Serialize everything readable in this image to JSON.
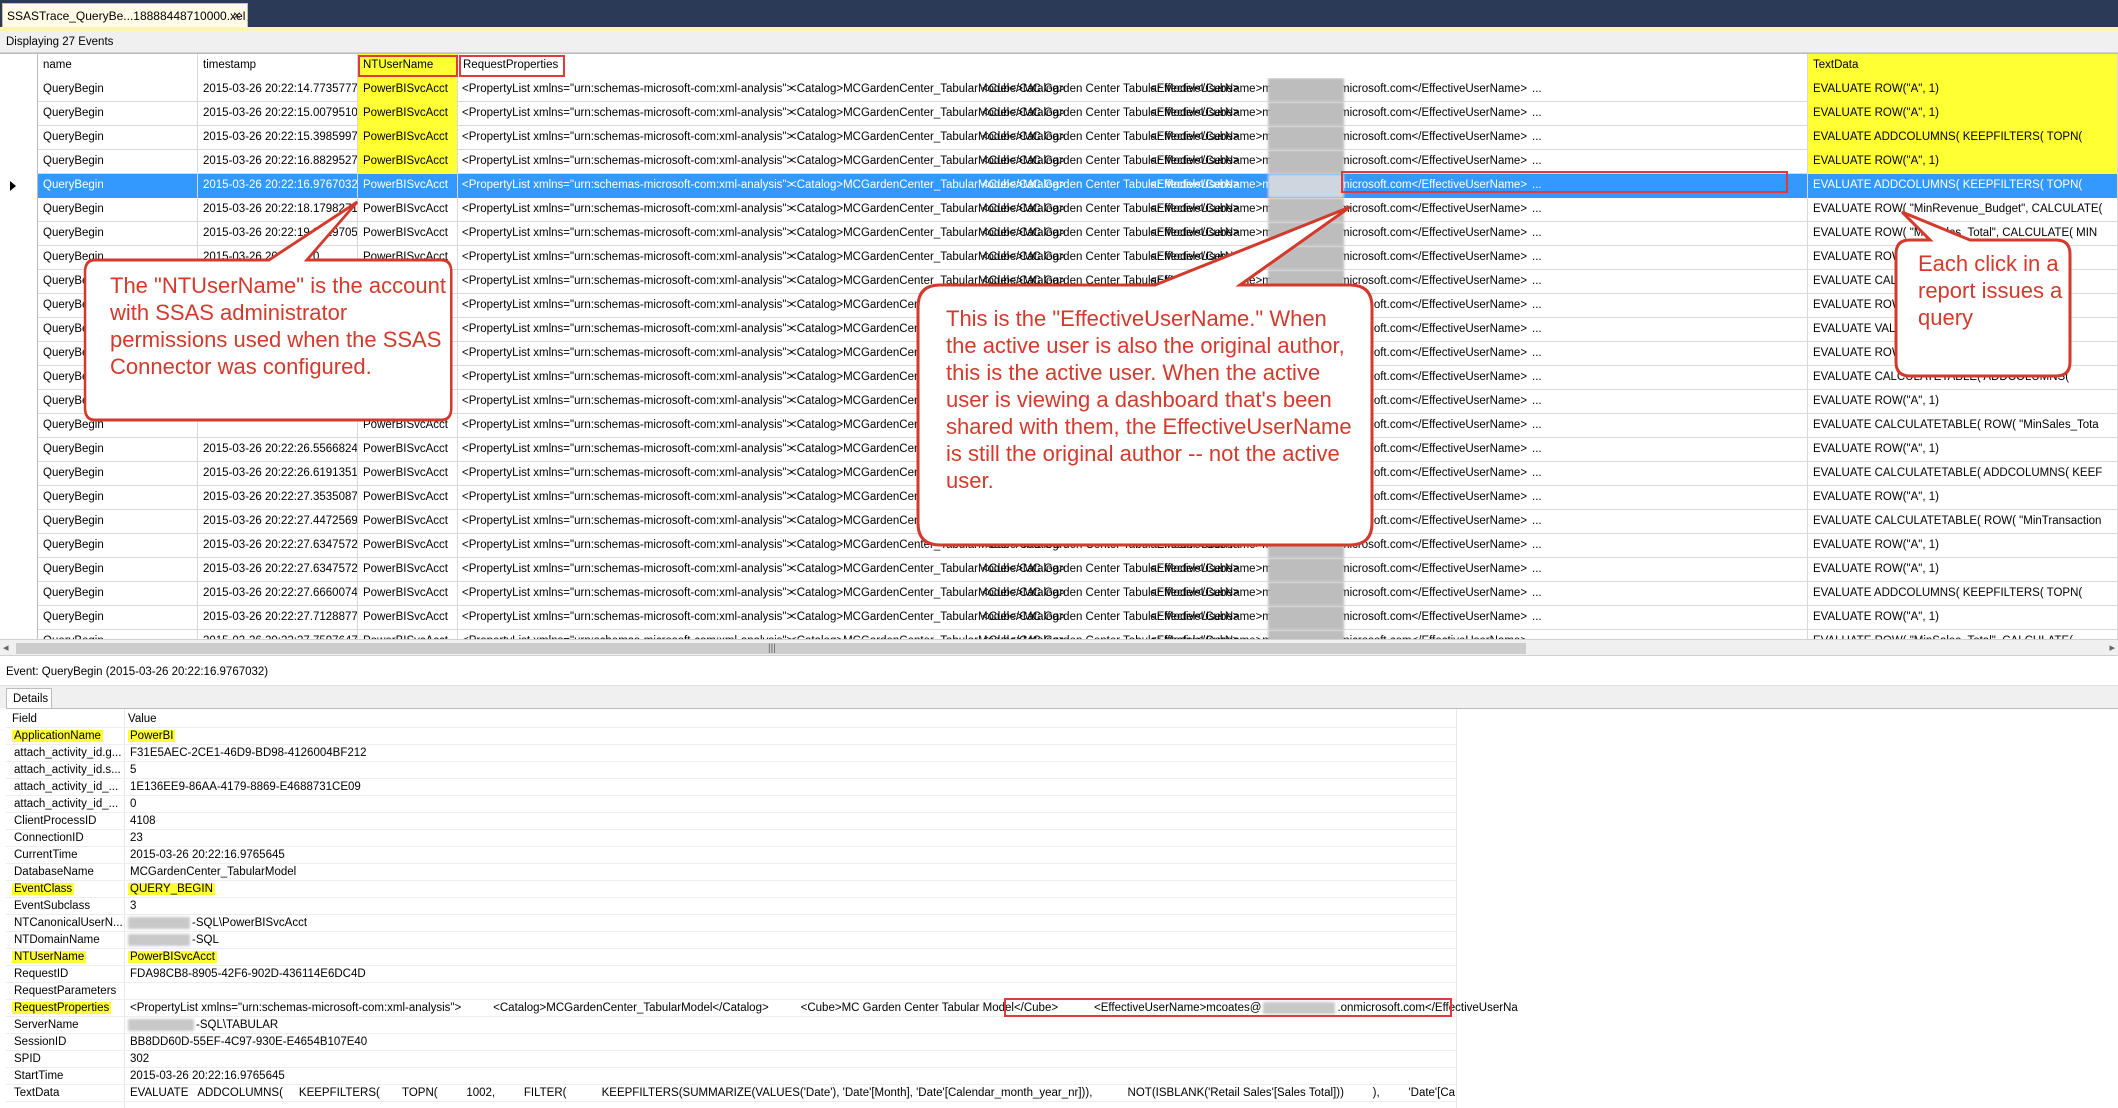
{
  "window": {
    "tab_title": "SSASTrace_QueryBe...18888448710000.xel",
    "tab_close": "×",
    "status": "Displaying 27 Events"
  },
  "grid": {
    "headers": {
      "name": "name",
      "timestamp": "timestamp",
      "ntusername": "NTUserName",
      "requestproperties": "RequestProperties",
      "textdata": "TextData"
    },
    "rows": [
      {
        "name": "QueryBegin",
        "timestamp": "2015-03-26 20:22:14.7735777",
        "nt": "PowerBISvcAcct",
        "p1": "<PropertyList xmlns=\"urn:schemas-microsoft-com:xml-analysis\">",
        "p2": "<Catalog>MCGardenCenter_TabularModel</Catalog>",
        "p3": "<Cube>MC Garden Center Tabular Model</Cube>",
        "p4": "<EffectiveUserName>mcoates@",
        "p5": ".onmicrosoft.com</EffectiveUserName>",
        "dots": "...",
        "text": "EVALUATE ROW(\"A\", 1)",
        "hl": true
      },
      {
        "name": "QueryBegin",
        "timestamp": "2015-03-26 20:22:15.0079510",
        "nt": "PowerBISvcAcct",
        "p1": "<PropertyList xmlns=\"urn:schemas-microsoft-com:xml-analysis\">",
        "p2": "<Catalog>MCGardenCenter_TabularModel</Catalog>",
        "p3": "<Cube>MC Garden Center Tabular Model</Cube>",
        "p4": "<EffectiveUserName>mcoates@",
        "p5": ".onmicrosoft.com</EffectiveUserName>",
        "dots": "...",
        "text": "EVALUATE ROW(\"A\", 1)",
        "hl": true
      },
      {
        "name": "QueryBegin",
        "timestamp": "2015-03-26 20:22:15.3985997",
        "nt": "PowerBISvcAcct",
        "p1": "<PropertyList xmlns=\"urn:schemas-microsoft-com:xml-analysis\">",
        "p2": "<Catalog>MCGardenCenter_TabularModel</Catalog>",
        "p3": "<Cube>MC Garden Center Tabular Model</Cube>",
        "p4": "<EffectiveUserName>mcoates@",
        "p5": ".onmicrosoft.com</EffectiveUserName>",
        "dots": "...",
        "text": "EVALUATE   ADDCOLUMNS(     KEEPFILTERS(       TOPN(",
        "hl": true
      },
      {
        "name": "QueryBegin",
        "timestamp": "2015-03-26 20:22:16.8829527",
        "nt": "PowerBISvcAcct",
        "p1": "<PropertyList xmlns=\"urn:schemas-microsoft-com:xml-analysis\">",
        "p2": "<Catalog>MCGardenCenter_TabularModel</Catalog>",
        "p3": "<Cube>MC Garden Center Tabular Model</Cube>",
        "p4": "<EffectiveUserName>mcoates@",
        "p5": ".onmicrosoft.com</EffectiveUserName>",
        "dots": "...",
        "text": "EVALUATE ROW(\"A\", 1)",
        "hl": true
      },
      {
        "name": "QueryBegin",
        "timestamp": "2015-03-26 20:22:16.9767032",
        "nt": "PowerBISvcAcct",
        "p1": "<PropertyList xmlns=\"urn:schemas-microsoft-com:xml-analysis\">",
        "p2": "<Catalog>MCGardenCenter_TabularModel</Catalog>",
        "p3": "<Cube>MC Garden Center Tabular Model</Cube>",
        "p4": "<EffectiveUserName>mcoates@",
        "p5": ".onmicrosoft.com</EffectiveUserName>",
        "dots": "...",
        "text": "EVALUATE   ADDCOLUMNS(     KEEPFILTERS(       TOPN(",
        "hl": true,
        "selected": true
      },
      {
        "name": "QueryBegin",
        "timestamp": "2015-03-26 20:22:18.1798271",
        "nt": "PowerBISvcAcct",
        "p1": "<PropertyList xmlns=\"urn:schemas-microsoft-com:xml-analysis\">",
        "p2": "<Catalog>MCGardenCenter_TabularModel</Catalog>",
        "p3": "<Cube>MC Garden Center Tabular Model</Cube>",
        "p4": "<EffectiveUserName>mcoates@",
        "p5": ".onmicrosoft.com</EffectiveUserName>",
        "dots": "...",
        "text": "EVALUATE     ROW(     \"MinRevenue_Budget\", CALCULATE("
      },
      {
        "name": "QueryBegin",
        "timestamp": "2015-03-26 20:22:19.3829705",
        "nt": "PowerBISvcAcct",
        "p1": "<PropertyList xmlns=\"urn:schemas-microsoft-com:xml-analysis\">",
        "p2": "<Catalog>MCGardenCenter_TabularModel</Catalog>",
        "p3": "<Cube>MC Garden Center Tabular Model</Cube>",
        "p4": "<EffectiveUserName>mcoates@",
        "p5": ".onmicrosoft.com</EffectiveUserName>",
        "dots": "...",
        "text": "EVALUATE   ROW(     \"MinSales_Total\", CALCULATE(     MIN"
      },
      {
        "name": "QueryBegin",
        "timestamp": "2015-03-26 20:22:20.0",
        "nt": "PowerBISvcAcct",
        "p1": "<PropertyList xmlns=\"urn:schemas-microsoft-com:xml-analysis\">",
        "p2": "<Catalog>MCGardenCenter_TabularModel</Catalog>",
        "p3": "<Cube>MC Garden Center Tabular Model</Cube>",
        "p4": "<EffectiveUserName>mcoates@",
        "p5": ".onmicrosoft.com</EffectiveUserName>",
        "dots": "...",
        "text": "EVALUATE ROW(\"A\", 1)"
      },
      {
        "name": "QueryBegin",
        "timestamp": "",
        "nt": "PowerBISvcAcct",
        "p1": "<PropertyList xmlns=\"urn:schemas-microsoft-com:xml-analysis\">",
        "p2": "<Catalog>MCGardenCenter_TabularModel</Catalog>",
        "p3": "<Cube>MC Garden Center Tabular Model</Cube>",
        "p4": "<EffectiveUserName>mcoates@",
        "p5": ".onmicrosoft.com</EffectiveUserName>",
        "dots": "...",
        "text": "EVALUATE   CALCULATETABLE(     KEEPFILTERS("
      },
      {
        "name": "QueryBegin",
        "timestamp": "",
        "nt": "PowerBISvcAcct",
        "p1": "<PropertyList xmlns=\"urn:schemas-microsoft-com:xml-analysis\">",
        "p2": "<Catalog>MCGardenCenter_TabularModel</Catalog>",
        "p3": "<Cube>MC Garden Center Tabular Model</Cube>",
        "p4": "<EffectiveUserName>mcoates@",
        "p5": ".onmicrosoft.com</EffectiveUserName>",
        "dots": "...",
        "text": "EVALUATE ROW(\"A\", 1)"
      },
      {
        "name": "QueryBegin",
        "timestamp": "",
        "nt": "PowerBISvcAcct",
        "p1": "<PropertyList xmlns=\"urn:schemas-microsoft-com:xml-analysis\">",
        "p2": "<Catalog>MCGardenCenter_TabularModel</Catalog>",
        "p3": "<Cube>MC Garden Center Tabular Model</Cube>",
        "p4": "<EffectiveUserName>mcoates@",
        "p5": ".onmicrosoft.com</EffectiveUserName>",
        "dots": "...",
        "text": "EVALUATE   VALUES('Date'[Year])"
      },
      {
        "name": "QueryBegin",
        "timestamp": "",
        "nt": "PowerBISvcAcct",
        "p1": "<PropertyList xmlns=\"urn:schemas-microsoft-com:xml-analysis\">",
        "p2": "<Catalog>MCGardenCenter_TabularModel</Catalog>",
        "p3": "<Cube>MC Garden Center Tabular Model</Cube>",
        "p4": "<EffectiveUserName>mcoates@",
        "p5": ".onmicrosoft.com</EffectiveUserName>",
        "dots": "...",
        "text": "EVALUATE ROW(\"A\", 1)"
      },
      {
        "name": "QueryBegin",
        "timestamp": "",
        "nt": "PowerBISvcAcct",
        "p1": "<PropertyList xmlns=\"urn:schemas-microsoft-com:xml-analysis\">",
        "p2": "<Catalog>MCGardenCenter_TabularModel</Catalog>",
        "p3": "<Cube>MC Garden Center Tabular Model</Cube>",
        "p4": "<EffectiveUserName>mcoates@",
        "p5": ".onmicrosoft.com</EffectiveUserName>",
        "dots": "...",
        "text": "EVALUATE   CALCULATETABLE(     ADDCOLUMNS("
      },
      {
        "name": "QueryBegin",
        "timestamp": "",
        "nt": "PowerBISvcAcct",
        "p1": "<PropertyList xmlns=\"urn:schemas-microsoft-com:xml-analysis\">",
        "p2": "<Catalog>MCGardenCenter_TabularModel</Catalog>",
        "p3": "<Cube>MC Garden Center Tabular Model</Cube>",
        "p4": "<EffectiveUserName>mcoates@",
        "p5": ".onmicrosoft.com</EffectiveUserName>",
        "dots": "...",
        "text": "EVALUATE ROW(\"A\", 1)"
      },
      {
        "name": "QueryBegin",
        "timestamp": "",
        "nt": "PowerBISvcAcct",
        "p1": "<PropertyList xmlns=\"urn:schemas-microsoft-com:xml-analysis\">",
        "p2": "<Catalog>MCGardenCenter_TabularModel</Catalog>",
        "p3": "<Cube>MC Garden Center Tabular Model</Cube>",
        "p4": "<EffectiveUserName>mcoates@",
        "p5": ".onmicrosoft.com</EffectiveUserName>",
        "dots": "...",
        "text": "EVALUATE   CALCULATETABLE(     ROW(     \"MinSales_Tota"
      },
      {
        "name": "QueryBegin",
        "timestamp": "2015-03-26 20:22:26.5566824",
        "nt": "PowerBISvcAcct",
        "p1": "<PropertyList xmlns=\"urn:schemas-microsoft-com:xml-analysis\">",
        "p2": "<Catalog>MCGardenCenter_TabularModel</Catalog>",
        "p3": "<Cube>MC Garden Center Tabular Model</Cube>",
        "p4": "<EffectiveUserName>mcoates@",
        "p5": ".onmicrosoft.com</EffectiveUserName>",
        "dots": "...",
        "text": "EVALUATE ROW(\"A\", 1)"
      },
      {
        "name": "QueryBegin",
        "timestamp": "2015-03-26 20:22:26.6191351",
        "nt": "PowerBISvcAcct",
        "p1": "<PropertyList xmlns=\"urn:schemas-microsoft-com:xml-analysis\">",
        "p2": "<Catalog>MCGardenCenter_TabularModel</Catalog>",
        "p3": "<Cube>MC Garden Center Tabular Model</Cube>",
        "p4": "<EffectiveUserName>mcoates@",
        "p5": ".onmicrosoft.com</EffectiveUserName>",
        "dots": "...",
        "text": "EVALUATE   CALCULATETABLE(     ADDCOLUMNS(     KEEF"
      },
      {
        "name": "QueryBegin",
        "timestamp": "2015-03-26 20:22:27.3535087",
        "nt": "PowerBISvcAcct",
        "p1": "<PropertyList xmlns=\"urn:schemas-microsoft-com:xml-analysis\">",
        "p2": "<Catalog>MCGardenCenter_TabularModel</Catalog>",
        "p3": "<Cube>MC Garden Center Tabular Model</Cube>",
        "p4": "<EffectiveUserName>mcoates@",
        "p5": ".onmicrosoft.com</EffectiveUserName>",
        "dots": "...",
        "text": "EVALUATE ROW(\"A\", 1)"
      },
      {
        "name": "QueryBegin",
        "timestamp": "2015-03-26 20:22:27.4472569",
        "nt": "PowerBISvcAcct",
        "p1": "<PropertyList xmlns=\"urn:schemas-microsoft-com:xml-analysis\">",
        "p2": "<Catalog>MCGardenCenter_TabularModel</Catalog>",
        "p3": "<Cube>MC Garden Center Tabular Model</Cube>",
        "p4": "<EffectiveUserName>mcoates@",
        "p5": ".onmicrosoft.com</EffectiveUserName>",
        "dots": "...",
        "text": "EVALUATE   CALCULATETABLE(     ROW(     \"MinTransaction"
      },
      {
        "name": "QueryBegin",
        "timestamp": "2015-03-26 20:22:27.6347572",
        "nt": "PowerBISvcAcct",
        "p1": "<PropertyList xmlns=\"urn:schemas-microsoft-com:xml-analysis\">",
        "p2": "<Catalog>MCGardenCenter_TabularModel</Catalog>",
        "p3": "<Cube>MC Garden Center Tabular Model</Cube>",
        "p4": "<EffectiveUserName>mcoates@",
        "p5": ".onmicrosoft.com</EffectiveUserName>",
        "dots": "...",
        "text": "EVALUATE ROW(\"A\", 1)"
      },
      {
        "name": "QueryBegin",
        "timestamp": "2015-03-26 20:22:27.6347572",
        "nt": "PowerBISvcAcct",
        "p1": "<PropertyList xmlns=\"urn:schemas-microsoft-com:xml-analysis\">",
        "p2": "<Catalog>MCGardenCenter_TabularModel</Catalog>",
        "p3": "<Cube>MC Garden Center Tabular Model</Cube>",
        "p4": "<EffectiveUserName>mcoates@",
        "p5": ".onmicrosoft.com</EffectiveUserName>",
        "dots": "...",
        "text": "EVALUATE ROW(\"A\", 1)"
      },
      {
        "name": "QueryBegin",
        "timestamp": "2015-03-26 20:22:27.6660074",
        "nt": "PowerBISvcAcct",
        "p1": "<PropertyList xmlns=\"urn:schemas-microsoft-com:xml-analysis\">",
        "p2": "<Catalog>MCGardenCenter_TabularModel</Catalog>",
        "p3": "<Cube>MC Garden Center Tabular Model</Cube>",
        "p4": "<EffectiveUserName>mcoates@",
        "p5": ".onmicrosoft.com</EffectiveUserName>",
        "dots": "...",
        "text": "EVALUATE   ADDCOLUMNS(     KEEPFILTERS(       TOPN("
      },
      {
        "name": "QueryBegin",
        "timestamp": "2015-03-26 20:22:27.7128877",
        "nt": "PowerBISvcAcct",
        "p1": "<PropertyList xmlns=\"urn:schemas-microsoft-com:xml-analysis\">",
        "p2": "<Catalog>MCGardenCenter_TabularModel</Catalog>",
        "p3": "<Cube>MC Garden Center Tabular Model</Cube>",
        "p4": "<EffectiveUserName>mcoates@",
        "p5": ".onmicrosoft.com</EffectiveUserName>",
        "dots": "...",
        "text": "EVALUATE ROW(\"A\", 1)"
      },
      {
        "name": "QueryBegin",
        "timestamp": "2015-03-26 20:22:27.7597647",
        "nt": "PowerBISvcAcct",
        "p1": "<PropertyList xmlns=\"urn:schemas-microsoft-com:xml-analysis\">",
        "p2": "<Catalog>MCGardenCenter_TabularModel</Catalog>",
        "p3": "<Cube>MC Garden Center Tabular Model</Cube>",
        "p4": "<EffectiveUserName>mcoates@",
        "p5": ".onmicrosoft.com</EffectiveUserName>",
        "dots": "...",
        "text": "EVALUATE   ROW(     \"MinSales_Total\", CALCULATE("
      }
    ]
  },
  "event_line": "Event: QueryBegin (2015-03-26 20:22:16.9767032)",
  "details": {
    "tab_label": "Details",
    "header_field": "Field",
    "header_value": "Value",
    "rows": [
      {
        "f": "ApplicationName",
        "v": "PowerBI",
        "hl": true
      },
      {
        "f": "attach_activity_id.g...",
        "v": "F31E5AEC-2CE1-46D9-BD98-4126004BF212"
      },
      {
        "f": "attach_activity_id.s...",
        "v": "5"
      },
      {
        "f": "attach_activity_id_...",
        "v": "1E136EE9-86AA-4179-8869-E4688731CE09"
      },
      {
        "f": "attach_activity_id_...",
        "v": "0"
      },
      {
        "f": "ClientProcessID",
        "v": "4108"
      },
      {
        "f": "ConnectionID",
        "v": "23"
      },
      {
        "f": "CurrentTime",
        "v": "2015-03-26 20:22:16.9765645"
      },
      {
        "f": "DatabaseName",
        "v": "MCGardenCenter_TabularModel"
      },
      {
        "f": "EventClass",
        "v": "QUERY_BEGIN",
        "hl": true
      },
      {
        "f": "EventSubclass",
        "v": "3"
      },
      {
        "f": "NTCanonicalUserN...",
        "v": "-SQL\\PowerBISvcAcct",
        "blur": 62
      },
      {
        "f": "NTDomainName",
        "v": "-SQL",
        "blur": 62
      },
      {
        "f": "NTUserName",
        "v": "PowerBISvcAcct",
        "hl": true
      },
      {
        "f": "RequestID",
        "v": "FDA98CB8-8905-42F6-902D-436114E6DC4D"
      },
      {
        "f": "RequestParameters",
        "v": ""
      },
      {
        "f": "RequestProperties",
        "v": "<PropertyList xmlns=\"urn:schemas-microsoft-com:xml-analysis\">          <Catalog>MCGardenCenter_TabularModel</Catalog>          <Cube>MC Garden Center Tabular Model</Cube>          ",
        "v2": "<EffectiveUserName>mcoates@",
        "v3": ".onmicrosoft.com</EffectiveUserNa",
        "hl": true,
        "special": true
      },
      {
        "f": "ServerName",
        "v": "-SQL\\TABULAR",
        "blur": 66
      },
      {
        "f": "SessionID",
        "v": "BB8DD60D-55EF-4C97-930E-E4654B107E40"
      },
      {
        "f": "SPID",
        "v": "302"
      },
      {
        "f": "StartTime",
        "v": "2015-03-26 20:22:16.9765645"
      },
      {
        "f": "TextData",
        "v": "EVALUATE   ADDCOLUMNS(     KEEPFILTERS(       TOPN(         1002,         FILTER(           KEEPFILTERS(SUMMARIZE(VALUES('Date'), 'Date'[Month], 'Date'[Calendar_month_year_nr])),           NOT(ISBLANK('Retail Sales'[Sales Total]))         ),         'Date'[Ca"
      }
    ]
  },
  "callouts": {
    "ntusername": "The \"NTUserName\" is the account with SSAS administrator permissions used when the SSAS Connector was configured.",
    "effectiveusername": "This is the \"EffectiveUserName.\" When the active user is also the original author, this is the active user. When the active user is viewing a dashboard that's been shared with them, the EffectiveUserName is still the original author -- not the active user.",
    "click": "Each click in a report issues a query"
  },
  "colors": {
    "highlight": "#ffff33",
    "selection": "#3399ff",
    "callout_border": "#d33a2c",
    "callout_text": "#d33a2c",
    "annotation_box": "#e23a3a"
  }
}
